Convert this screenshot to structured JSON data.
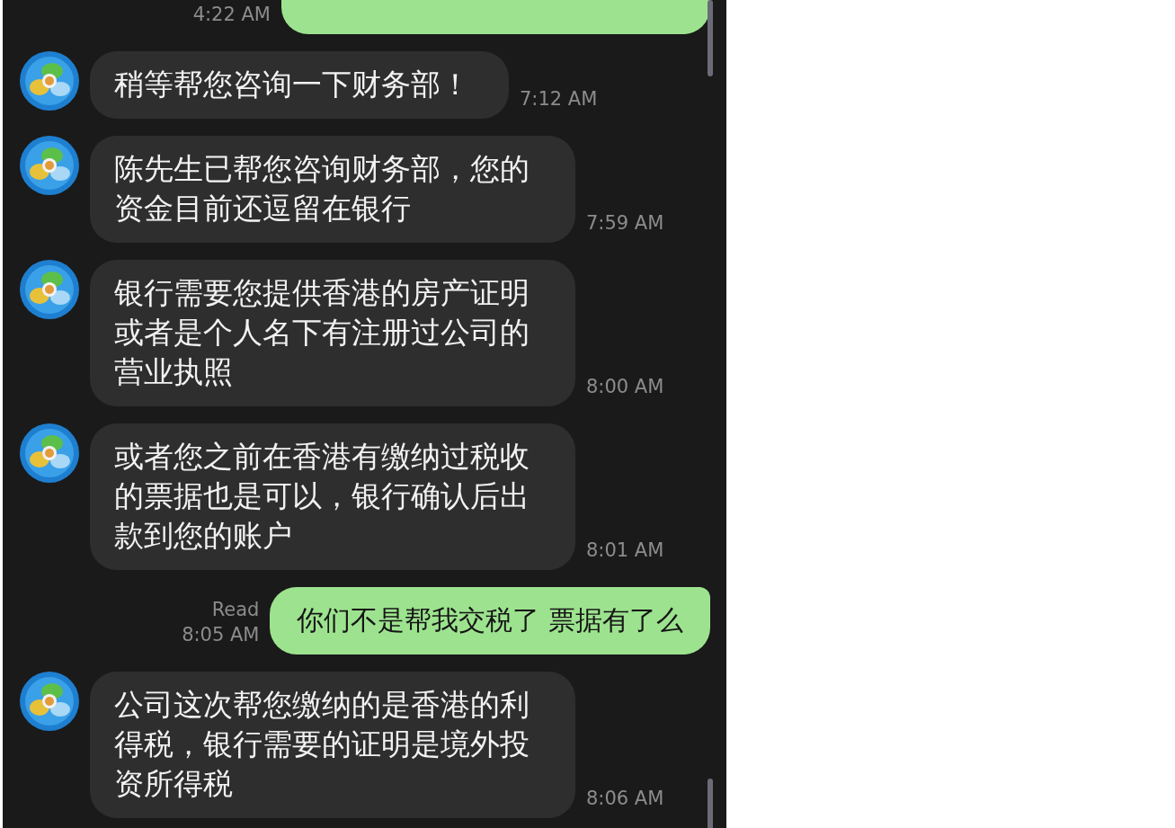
{
  "messages": [
    {
      "kind": "outgoing",
      "time": "4:22 AM"
    },
    {
      "kind": "incoming",
      "text": "稍等帮您咨询一下财务部！",
      "time": "7:12 AM"
    },
    {
      "kind": "incoming",
      "text": "陈先生已帮您咨询财务部，您的资金目前还逗留在银行",
      "time": "7:59 AM"
    },
    {
      "kind": "incoming",
      "text": "银行需要您提供香港的房产证明或者是个人名下有注册过公司的营业执照",
      "time": "8:00 AM"
    },
    {
      "kind": "incoming",
      "text": "或者您之前在香港有缴纳过税收的票据也是可以，银行确认后出款到您的账户",
      "time": "8:01 AM"
    },
    {
      "kind": "outgoing",
      "text": "你们不是帮我交税了 票据有了么",
      "time": "8:05 AM",
      "status": "Read"
    },
    {
      "kind": "incoming",
      "text": "公司这次帮您缴纳的是香港的利得税，银行需要的证明是境外投资所得税",
      "time": "8:06 AM"
    }
  ]
}
